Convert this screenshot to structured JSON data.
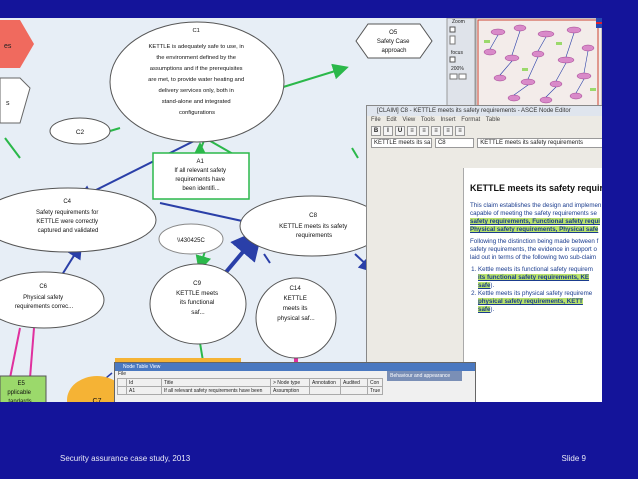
{
  "nodes": {
    "e_left": "es",
    "s_left": "s",
    "c1": [
      "C1",
      "KETTLE is adequately safe to use, in",
      "the environment defined by the",
      "assumptions and if the prerequisites",
      "are met, to provide water heating and",
      "delivery services only, both in",
      "stand-alone and integrated",
      "configurations"
    ],
    "o5": [
      "O5",
      "Safety Case",
      "approach"
    ],
    "c2": "C2",
    "a1": [
      "A1",
      "If all relevant safety",
      "requirements have",
      "been identifi..."
    ],
    "c4": [
      "C4",
      "Safety requirements for",
      "KETTLE were correctly",
      "captured and validated"
    ],
    "ref": "\\\\430425C",
    "c8": [
      "C8",
      "KETTLE meets its safety",
      "requirements"
    ],
    "c6": [
      "C6",
      "Physical safety",
      "requirements correc..."
    ],
    "c9": [
      "C9",
      "KETTLE meets",
      "its functional",
      "saf..."
    ],
    "c14": [
      "C14",
      "KETTLE",
      "meets its",
      "physical saf..."
    ],
    "e5": [
      "E5",
      "pplicable",
      "tandards"
    ],
    "c7": "C7"
  },
  "zoom_panel": {
    "label_zoom": "Zoom",
    "label_focus": "focus",
    "value": "200%"
  },
  "editor": {
    "title": "[CLAIM] C8 - KETTLE meets its safety requirements - ASCE Node Editor",
    "menu": [
      "File",
      "Edit",
      "View",
      "Tools",
      "Insert",
      "Format",
      "Table"
    ],
    "tools": [
      "B",
      "I",
      "U",
      "≡",
      "≡",
      "≡",
      "≡",
      "≡"
    ],
    "field_name": "KETTLE meets its sa",
    "field_id": "C8",
    "field_summary": "KETTLE meets its safety requirements",
    "heading": "KETTLE meets its safety requir",
    "p1_lines": [
      "This claim establishes the design and implemen",
      "capable of meeting the safety requirements se"
    ],
    "p1_highlight1": "safety requirements, Functional safety requi",
    "p1_highlight2": "Physical safety requirements, Physical safe",
    "p2_lines": [
      "Following the distinction being made between f",
      "safety requirements, the evidence in support o",
      "laid out in terms of the following two sub-claim"
    ],
    "li1_text": "Kettle meets its functional safety requirem",
    "li1_link1": "its functional safety requirements, KE",
    "li1_link2": "safe",
    "li1_tail": ").",
    "li2_text": "Kettle meets its physical safety requireme",
    "li2_link1": "physical safety requirements, KETT",
    "li2_link2": "safe",
    "li2_tail": ")."
  },
  "node_table": {
    "title": "Node Table View",
    "menu": "File",
    "headers": [
      "Id",
      "Title",
      "> Node type",
      "Annotation",
      "Audited",
      "Con"
    ],
    "row": [
      "A1",
      "If all relevant safety requirements have been",
      "Assumption",
      "",
      "",
      "True"
    ],
    "side_label": "Behaviour and appearance"
  },
  "footer": {
    "left": "Security assurance case study, 2013",
    "right": "Slide 9"
  }
}
